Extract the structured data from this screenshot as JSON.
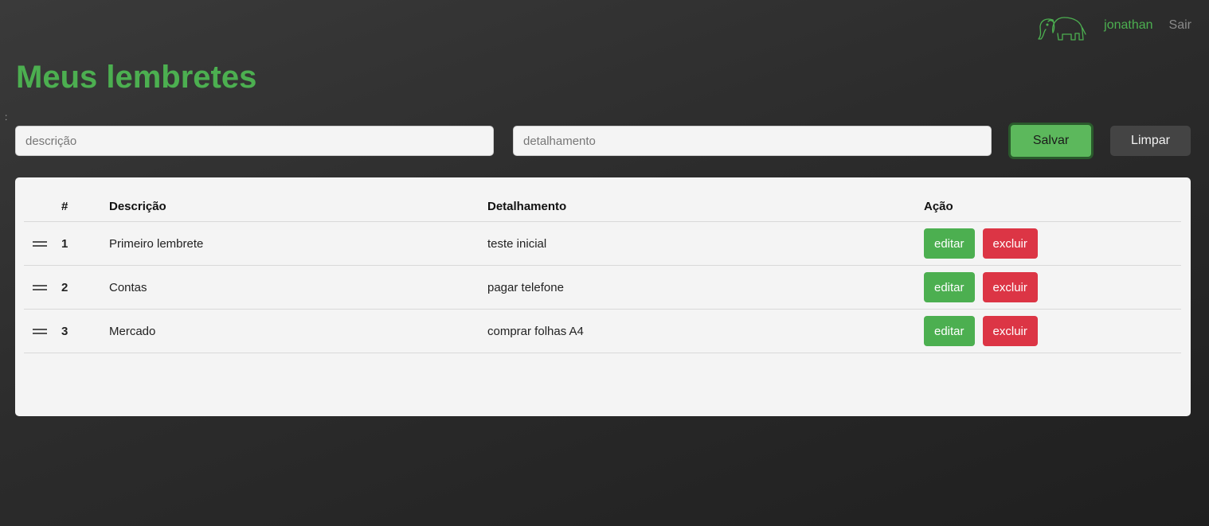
{
  "nav": {
    "logo_icon": "elephant-icon",
    "username": "jonathan",
    "logout_label": "Sair"
  },
  "page": {
    "title": "Meus lembretes",
    "stray_mark": ":"
  },
  "form": {
    "description_placeholder": "descrição",
    "detail_placeholder": "detalhamento",
    "save_label": "Salvar",
    "clear_label": "Limpar"
  },
  "table": {
    "headers": {
      "num": "#",
      "description": "Descrição",
      "detail": "Detalhamento",
      "action": "Ação"
    },
    "rows": [
      {
        "num": "1",
        "description": "Primeiro lembrete",
        "detail": "teste inicial",
        "edit_label": "editar",
        "delete_label": "excluir"
      },
      {
        "num": "2",
        "description": "Contas",
        "detail": "pagar telefone",
        "edit_label": "editar",
        "delete_label": "excluir"
      },
      {
        "num": "3",
        "description": "Mercado",
        "detail": "comprar folhas A4",
        "edit_label": "editar",
        "delete_label": "excluir"
      }
    ]
  },
  "colors": {
    "accent_green": "#4caf50",
    "delete_red": "#dc3545",
    "background": "#2c2c2c",
    "card": "#f4f4f4"
  }
}
